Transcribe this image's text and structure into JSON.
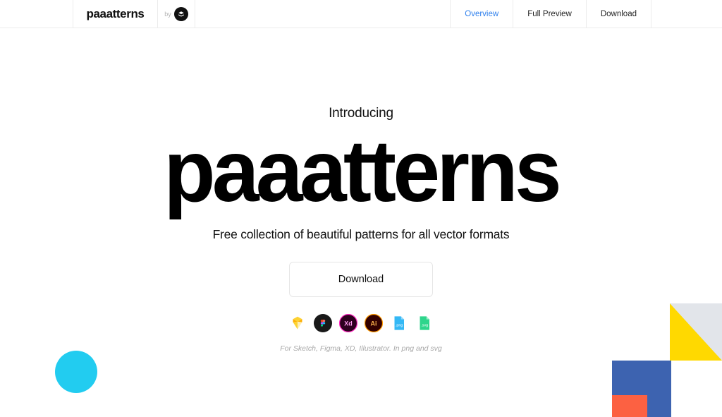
{
  "header": {
    "brand": "paaatterns",
    "by_label": "by",
    "by_badge_icon": "studio-logo-badge-icon",
    "nav": [
      {
        "label": "Overview",
        "active": true
      },
      {
        "label": "Full Preview",
        "active": false
      },
      {
        "label": "Download",
        "active": false
      }
    ]
  },
  "hero": {
    "eyebrow": "Introducing",
    "wordmark": "paaatterns",
    "tagline": "Free collection of beautiful patterns for all vector formats",
    "cta_label": "Download",
    "caption": "For Sketch, Figma, XD, Illustrator. In png and svg",
    "formats": [
      {
        "name": "sketch-icon",
        "label": "Sketch"
      },
      {
        "name": "figma-icon",
        "label": "Figma"
      },
      {
        "name": "adobe-xd-icon",
        "label": "Xd"
      },
      {
        "name": "adobe-illustrator-icon",
        "label": "Ai"
      },
      {
        "name": "png-file-icon",
        "label": ".png"
      },
      {
        "name": "svg-file-icon",
        "label": ".svg"
      }
    ]
  },
  "decorations": [
    {
      "name": "cyan-circle",
      "color": "#22CCF0"
    },
    {
      "name": "blue-square",
      "color": "#3D63B0"
    },
    {
      "name": "orange-square",
      "color": "#FC6142"
    },
    {
      "name": "yellow-grey-triangle-square",
      "color": "#FFD900",
      "secondary_color": "#E2E5EA"
    }
  ],
  "colors": {
    "accent_link": "#2f80ed",
    "text": "#111111",
    "muted_text": "#a9a9a9",
    "border": "#ececec",
    "background": "#ffffff"
  }
}
